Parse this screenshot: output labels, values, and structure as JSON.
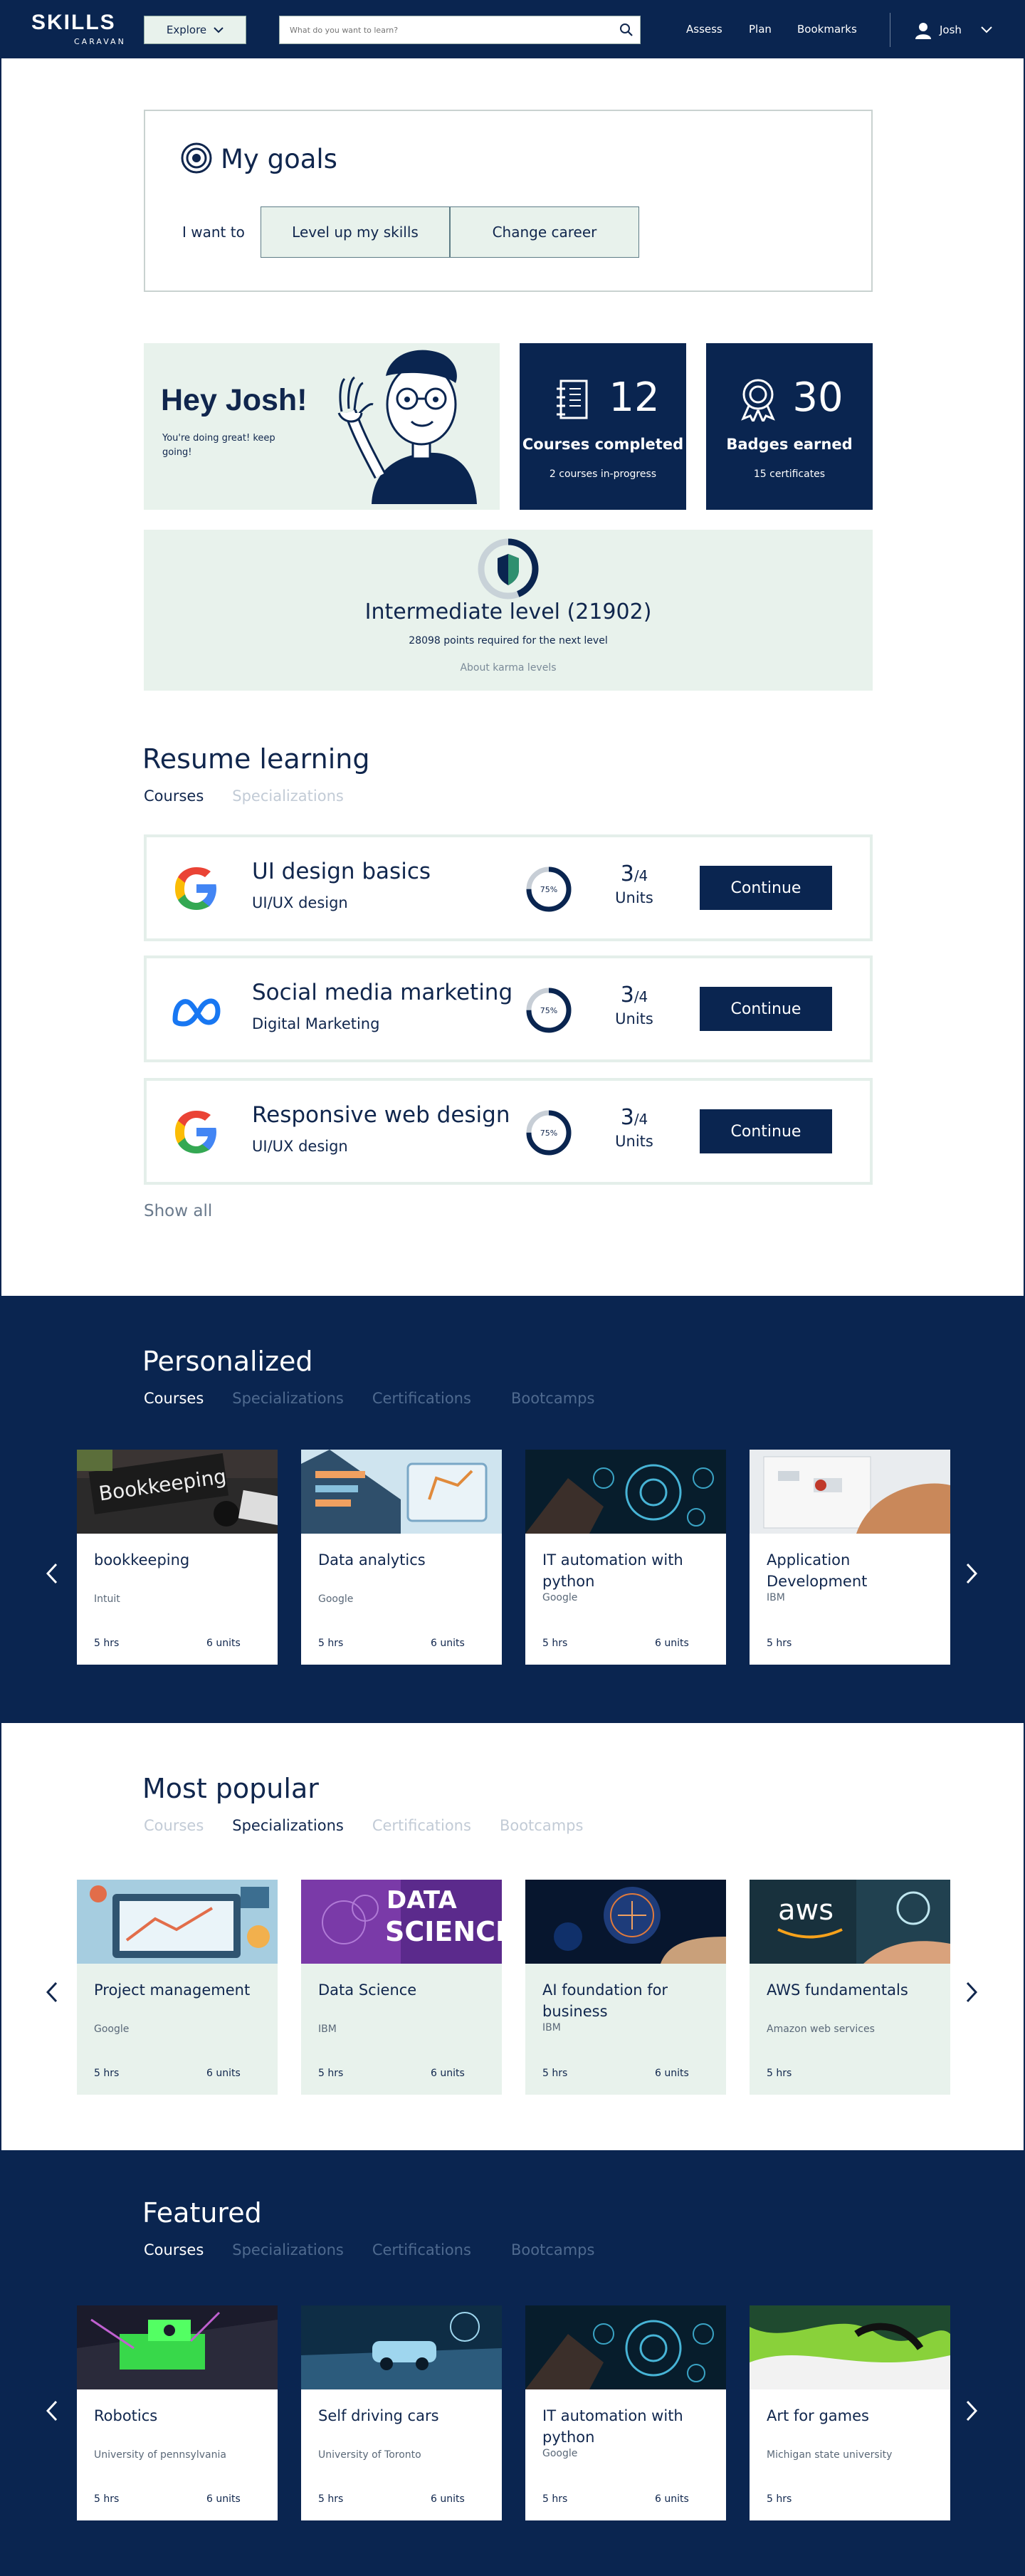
{
  "header": {
    "logo_top": "SKILLS",
    "logo_bottom": "CARAVAN",
    "explore": "Explore",
    "search_placeholder": "What do you want to learn?",
    "nav": [
      "Assess",
      "Plan",
      "Bookmarks"
    ],
    "user": "Josh"
  },
  "goals": {
    "title": "My goals",
    "want": "I want to",
    "options": [
      "Level up my skills",
      "Change career"
    ]
  },
  "greeting": {
    "title": "Hey Josh!",
    "subtitle": "You're doing great! keep going!"
  },
  "stats": [
    {
      "number": "12",
      "label": "Courses completed",
      "sub": "2 courses in-progress",
      "icon": "notebook-icon"
    },
    {
      "number": "30",
      "label": "Badges earned",
      "sub": "15 certificates",
      "icon": "award-ribbon-icon"
    }
  ],
  "level": {
    "title": "Intermediate level (21902)",
    "required": "28098 points required for the next level",
    "about": "About karma levels",
    "progress": 0.44
  },
  "resume": {
    "title": "Resume learning",
    "tabs": [
      "Courses",
      "Specializations"
    ],
    "items": [
      {
        "name": "UI design basics",
        "category": "UI/UX design",
        "progress_label": "75%",
        "progress": 0.75,
        "units_done": "3",
        "units_total": "/4",
        "units_label": "Units",
        "button": "Continue",
        "logo": "google-logo-icon"
      },
      {
        "name": "Social media marketing",
        "category": "Digital  Marketing",
        "progress_label": "75%",
        "progress": 0.75,
        "units_done": "3",
        "units_total": "/4",
        "units_label": "Units",
        "button": "Continue",
        "logo": "meta-logo-icon"
      },
      {
        "name": "Responsive web design",
        "category": "UI/UX design",
        "progress_label": "75%",
        "progress": 0.75,
        "units_done": "3",
        "units_total": "/4",
        "units_label": "Units",
        "button": "Continue",
        "logo": "google-logo-icon"
      }
    ],
    "show_all": "Show all"
  },
  "personalized": {
    "title": "Personalized",
    "tabs": [
      "Courses",
      "Specializations",
      "Certifications",
      "Bootcamps"
    ],
    "cards": [
      {
        "title": "bookkeeping",
        "provider": "Intuit",
        "hours": "5 hrs",
        "units": "6 units",
        "image": "bookkeeping"
      },
      {
        "title": "Data analytics",
        "provider": "Google",
        "hours": "5 hrs",
        "units": "6 units",
        "image": "analytics"
      },
      {
        "title": "IT automation with python",
        "provider": "Google",
        "hours": "5 hrs",
        "units": "6 units",
        "image": "automation"
      },
      {
        "title": "Application Development",
        "provider": "IBM",
        "hours": "5 hrs",
        "units": "",
        "image": "appdev"
      }
    ]
  },
  "popular": {
    "title": "Most popular",
    "tabs": [
      "Courses",
      "Specializations",
      "Certifications",
      "Bootcamps"
    ],
    "cards": [
      {
        "title": "Project management",
        "provider": "Google",
        "hours": "5 hrs",
        "units": "6 units",
        "image": "pm"
      },
      {
        "title": "Data Science",
        "provider": "IBM",
        "hours": "5 hrs",
        "units": "6 units",
        "image": "datascience",
        "image_text_1": "DATA",
        "image_text_2": "SCIENCE"
      },
      {
        "title": "AI foundation for business",
        "provider": "IBM",
        "hours": "5 hrs",
        "units": "6 units",
        "image": "ai"
      },
      {
        "title": "AWS fundamentals",
        "provider": "Amazon web services",
        "hours": "5 hrs",
        "units": "",
        "image": "aws",
        "image_text_1": "aws"
      }
    ]
  },
  "featured": {
    "title": "Featured",
    "tabs": [
      "Courses",
      "Specializations",
      "Certifications",
      "Bootcamps"
    ],
    "cards": [
      {
        "title": "Robotics",
        "provider": "University of pennsylvania",
        "hours": "5 hrs",
        "units": "6 units",
        "image": "robotics"
      },
      {
        "title": "Self driving cars",
        "provider": "University of Toronto",
        "hours": "5 hrs",
        "units": "6 units",
        "image": "cars"
      },
      {
        "title": "IT automation with python",
        "provider": "Google",
        "hours": "5 hrs",
        "units": "6 units",
        "image": "automation"
      },
      {
        "title": "Art for games",
        "provider": "Michigan state university",
        "hours": "5 hrs",
        "units": "",
        "image": "art"
      }
    ]
  },
  "colors": {
    "navy": "#0a2550",
    "mint": "#e8f2ec",
    "muted_tab": "#4f6a8f"
  }
}
